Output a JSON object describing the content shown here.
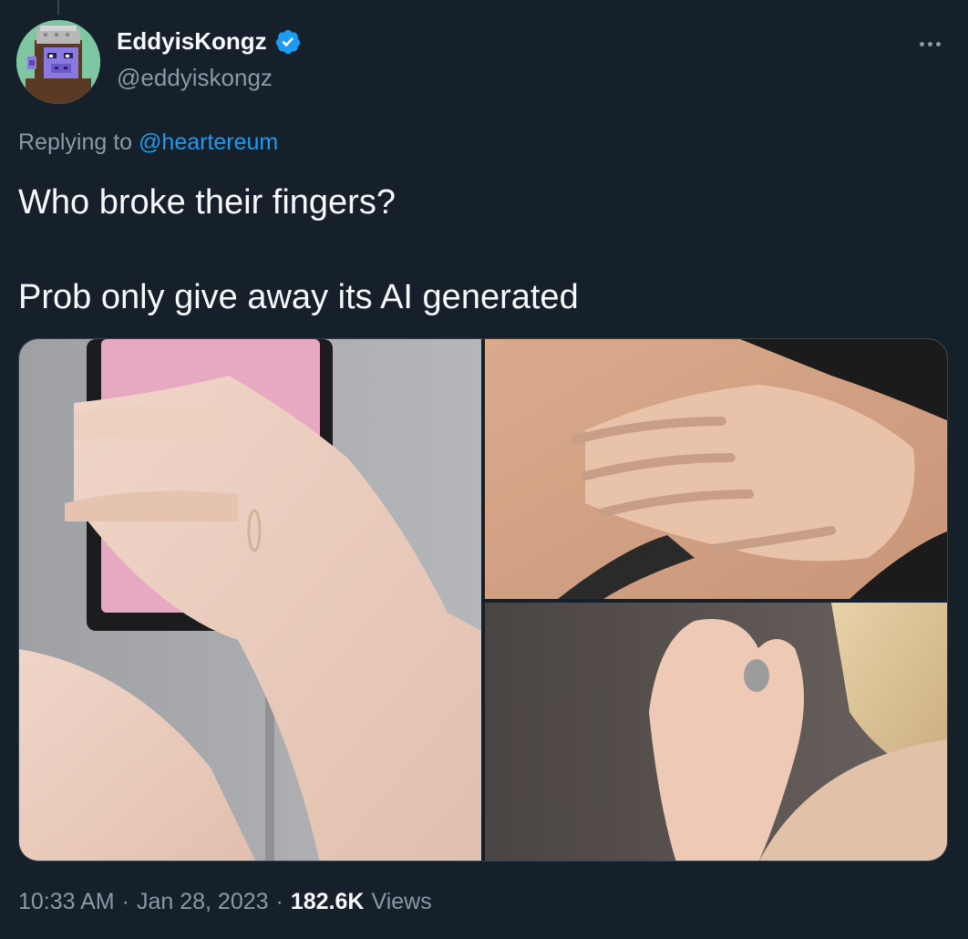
{
  "author": {
    "display_name": "EddyisKongz",
    "handle": "@eddyiskongz",
    "verified": true,
    "avatar_icon": "pixel-ape-avatar"
  },
  "reply": {
    "prefix": "Replying to",
    "mention": "@heartereum"
  },
  "tweet": {
    "line1": "Who broke their fingers?",
    "line2": "Prob only give away its AI generated"
  },
  "media": [
    {
      "name": "hand-holding-pink-phone"
    },
    {
      "name": "hand-on-shoulder"
    },
    {
      "name": "hand-pinching-object"
    }
  ],
  "meta": {
    "time": "10:33 AM",
    "date": "Jan 28, 2023",
    "views_count": "182.6K",
    "views_label": "Views",
    "separator": "·"
  },
  "colors": {
    "background": "#15202b",
    "text_primary": "#f7f9f9",
    "text_secondary": "#8b98a5",
    "accent": "#1d9bf0"
  },
  "icons": {
    "verified": "verified-badge-icon",
    "more": "more-options-icon"
  }
}
